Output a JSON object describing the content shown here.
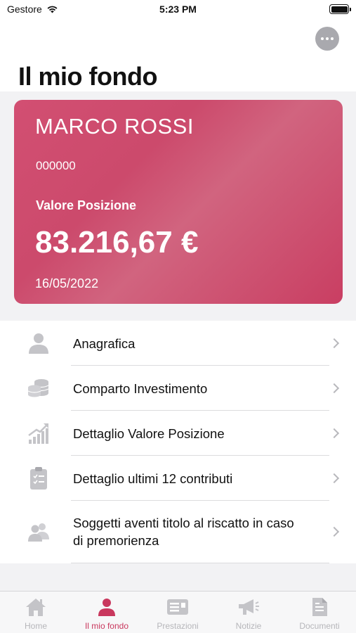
{
  "status_bar": {
    "carrier": "Gestore",
    "time": "5:23 PM"
  },
  "header": {
    "title": "Il mio fondo"
  },
  "card": {
    "name": "MARCO ROSSI",
    "number": "000000",
    "label": "Valore Posizione",
    "amount": "83.216,67 €",
    "date": "16/05/2022"
  },
  "menu": {
    "items": [
      {
        "label": "Anagrafica",
        "icon": "person-icon"
      },
      {
        "label": "Comparto Investimento",
        "icon": "coins-icon"
      },
      {
        "label": "Dettaglio Valore Posizione",
        "icon": "growth-chart-icon"
      },
      {
        "label": "Dettaglio ultimi 12 contributi",
        "icon": "clipboard-icon"
      },
      {
        "label": "Soggetti aventi titolo al riscatto in caso di premorienza",
        "icon": "people-icon"
      }
    ]
  },
  "tabbar": {
    "tabs": [
      {
        "label": "Home",
        "icon": "home-icon"
      },
      {
        "label": "Il mio fondo",
        "icon": "person-icon",
        "active": true
      },
      {
        "label": "Prestazioni",
        "icon": "list-icon"
      },
      {
        "label": "Notizie",
        "icon": "megaphone-icon"
      },
      {
        "label": "Documenti",
        "icon": "document-icon"
      }
    ]
  },
  "colors": {
    "accent": "#c9385e",
    "card": "#d24f72",
    "inactive": "#b6b6ba"
  }
}
